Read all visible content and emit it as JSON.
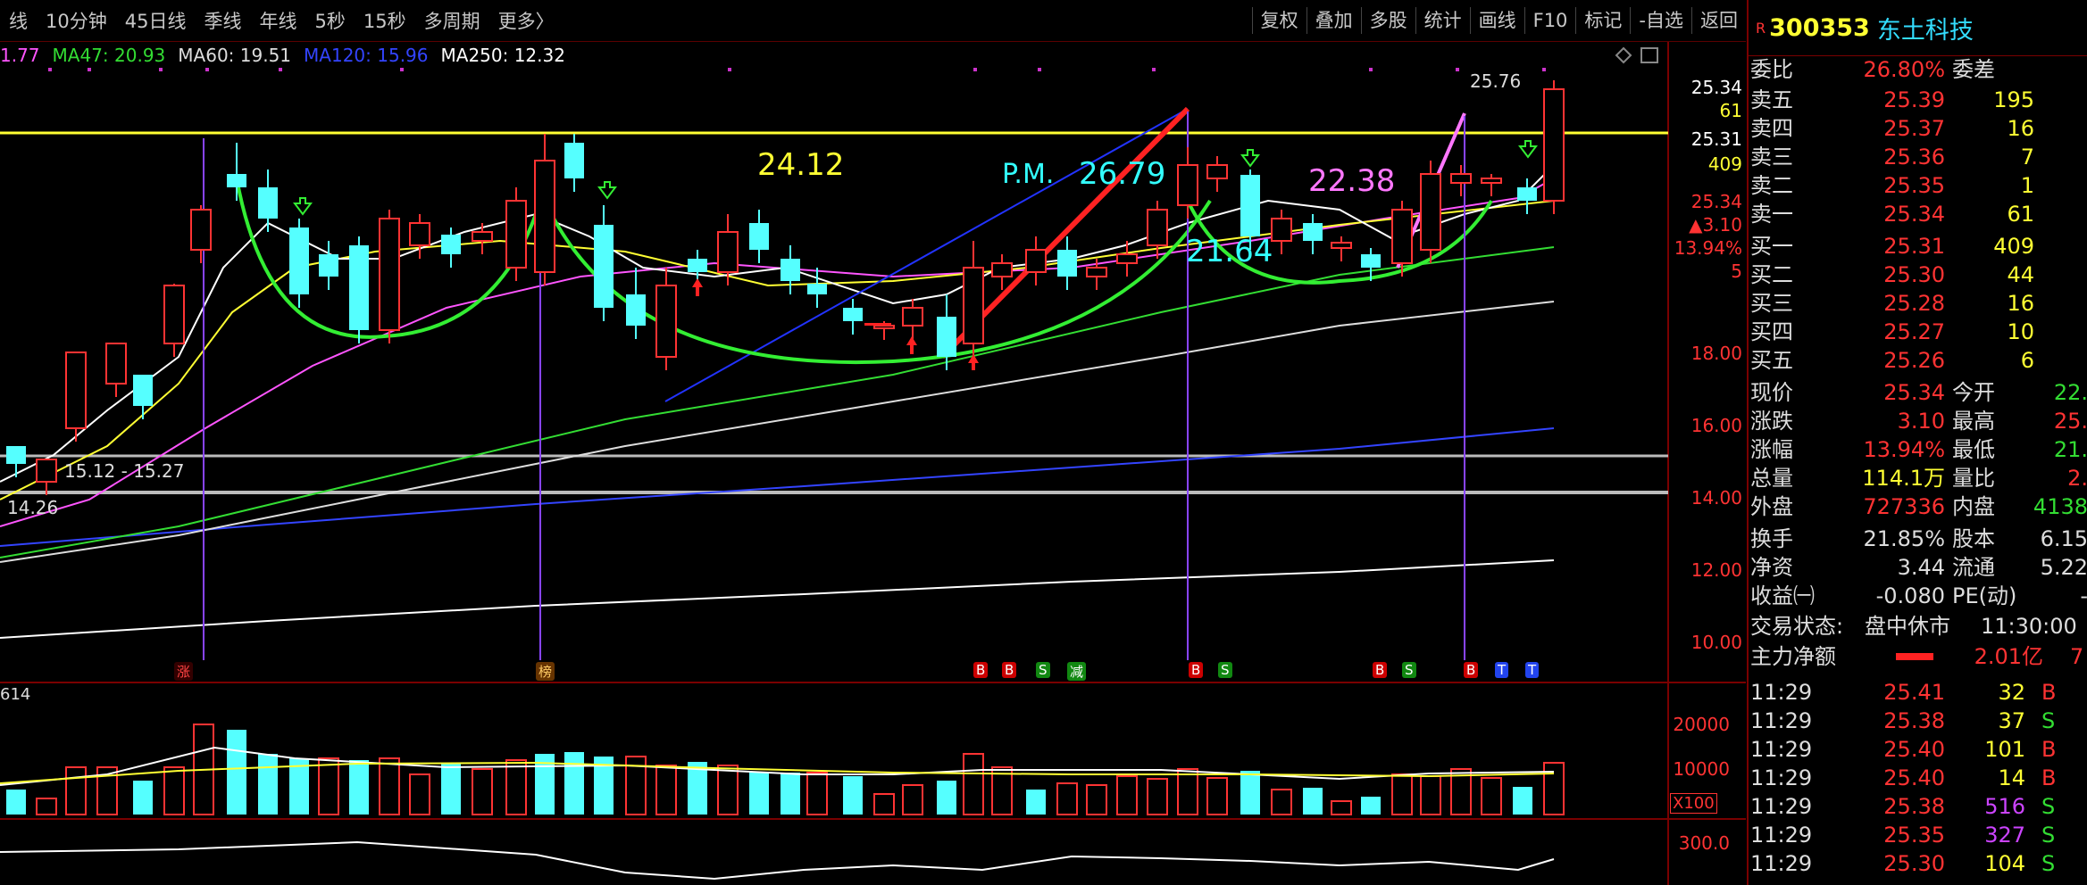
{
  "toolbar": {
    "periods": [
      "线",
      "10分钟",
      "45日线",
      "季线",
      "年线",
      "5秒",
      "15秒",
      "多周期",
      "更多〉"
    ],
    "tools": [
      "复权",
      "叠加",
      "多股",
      "统计",
      "画线",
      "F10",
      "标记",
      "-自选",
      "返回"
    ]
  },
  "ma_legend": [
    {
      "label": "1.77",
      "color": "#ff55ff"
    },
    {
      "label": "MA47: 20.93",
      "color": "#33dd33"
    },
    {
      "label": "MA60: 19.51",
      "color": "#dddddd"
    },
    {
      "label": "MA120: 15.96",
      "color": "#3344ff"
    },
    {
      "label": "MA250: 12.32",
      "color": "#ffffff"
    }
  ],
  "chart_annotations": {
    "level_24": "24.12",
    "pm": "P.M.",
    "pm_value": "26.79",
    "level_22": "22.38",
    "level_21": "21.64",
    "range_label": "15.12 - 15.27",
    "low_label": "14.26",
    "high_label": "25.76"
  },
  "price_axis": {
    "ticks": [
      "18.00",
      "16.00",
      "14.00",
      "12.00",
      "10.00"
    ],
    "quote_ask": "25.34",
    "quote_ask_vol": "61",
    "quote_bid": "25.31",
    "quote_bid_vol": "409",
    "last": "25.34",
    "change": "▲3.10",
    "change_pct": "13.94%",
    "mini": "5"
  },
  "signal_markers": [
    "涨",
    "榜",
    "B",
    "B",
    "S",
    "减",
    "B",
    "S",
    "B",
    "S",
    "B",
    "T",
    "T"
  ],
  "volume_panel": {
    "label": "614",
    "ticks": [
      "20000",
      "10000"
    ],
    "unit": "X100",
    "lower_tick": "300.0"
  },
  "stock": {
    "flag": "R",
    "code": "300353",
    "name": "东土科技",
    "weibi_label": "委比",
    "weibi": "26.80%",
    "weicha_label": "委差",
    "asks": [
      {
        "label": "卖五",
        "price": "25.39",
        "vol": "195"
      },
      {
        "label": "卖四",
        "price": "25.37",
        "vol": "16"
      },
      {
        "label": "卖三",
        "price": "25.36",
        "vol": "7"
      },
      {
        "label": "卖二",
        "price": "25.35",
        "vol": "1"
      },
      {
        "label": "卖一",
        "price": "25.34",
        "vol": "61"
      }
    ],
    "bids": [
      {
        "label": "买一",
        "price": "25.31",
        "vol": "409"
      },
      {
        "label": "买二",
        "price": "25.30",
        "vol": "44"
      },
      {
        "label": "买三",
        "price": "25.28",
        "vol": "16"
      },
      {
        "label": "买四",
        "price": "25.27",
        "vol": "10"
      },
      {
        "label": "买五",
        "price": "25.26",
        "vol": "6"
      }
    ],
    "stats": [
      {
        "l1": "现价",
        "v1": "25.34",
        "l2": "今开",
        "v2": "22.",
        "c1": "#ff3333",
        "c2": "#33dd33"
      },
      {
        "l1": "涨跌",
        "v1": "3.10",
        "l2": "最高",
        "v2": "25.",
        "c1": "#ff3333",
        "c2": "#ff3333"
      },
      {
        "l1": "涨幅",
        "v1": "13.94%",
        "l2": "最低",
        "v2": "21.",
        "c1": "#ff3333",
        "c2": "#33dd33"
      },
      {
        "l1": "总量",
        "v1": "114.1万",
        "l2": "量比",
        "v2": "2.",
        "c1": "#ffff33",
        "c2": "#ff3333"
      },
      {
        "l1": "外盘",
        "v1": "727336",
        "l2": "内盘",
        "v2": "4138",
        "c1": "#ff3333",
        "c2": "#33dd33"
      }
    ],
    "stats2": [
      {
        "l1": "换手",
        "v1": "21.85%",
        "l2": "股本",
        "v2": "6.15"
      },
      {
        "l1": "净资",
        "v1": "3.44",
        "l2": "流通",
        "v2": "5.22"
      },
      {
        "l1": "收益㈠",
        "v1": "-0.080",
        "l2": "PE(动)",
        "v2": "-"
      }
    ],
    "status_label": "交易状态:",
    "status_value": "盘中休市",
    "status_time": "11:30:00",
    "main_flow_label": "主力净额",
    "main_flow_value": "2.01亿",
    "main_flow_extra": "7"
  },
  "ticks": [
    {
      "time": "11:29",
      "price": "25.41",
      "vol": "32",
      "side": "B"
    },
    {
      "time": "11:29",
      "price": "25.38",
      "vol": "37",
      "side": "S"
    },
    {
      "time": "11:29",
      "price": "25.40",
      "vol": "101",
      "side": "B"
    },
    {
      "time": "11:29",
      "price": "25.40",
      "vol": "14",
      "side": "B"
    },
    {
      "time": "11:29",
      "price": "25.38",
      "vol": "516",
      "side": "S"
    },
    {
      "time": "11:29",
      "price": "25.35",
      "vol": "327",
      "side": "S"
    },
    {
      "time": "11:29",
      "price": "25.30",
      "vol": "104",
      "side": "S"
    }
  ],
  "colors": {
    "up": "#ff3333",
    "down": "#55ffff",
    "accent_yellow": "#ffff33",
    "green": "#33dd33"
  }
}
